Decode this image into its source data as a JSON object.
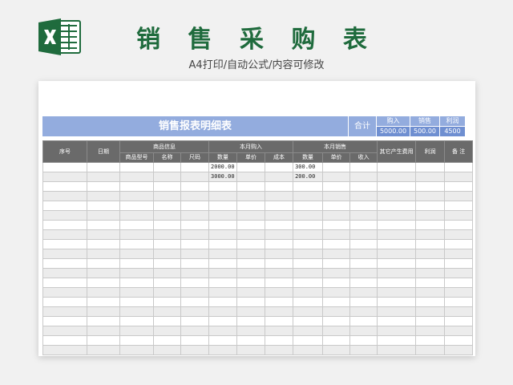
{
  "header": {
    "app_icon": "excel-icon",
    "title": "销 售 采 购 表",
    "subtitle": "A4打印/自动公式/内容可修改"
  },
  "colors": {
    "title_green": "#1f6b3d",
    "bar_blue": "#93acde",
    "bar_value_blue": "#6f8fd1",
    "header_gray": "#6a6a6a"
  },
  "sheet": {
    "bar_title": "销售报表明细表",
    "total_label": "合计",
    "summary": [
      {
        "label": "购入",
        "value": "5000.00"
      },
      {
        "label": "销售",
        "value": "500.00"
      },
      {
        "label": "利润",
        "value": "4500"
      }
    ],
    "headers": {
      "seq": "序号",
      "date": "日期",
      "goods_info": "商品信息",
      "purchase": "本月购入",
      "sales": "本月销售",
      "other_cost": "其它产生费用",
      "profit": "利润",
      "remark": "备 注",
      "model": "商品型号",
      "name": "名称",
      "size": "尺码",
      "p_qty": "数量",
      "p_price": "单价",
      "p_cost": "成本",
      "s_qty": "数量",
      "s_price": "单价",
      "s_income": "收入"
    },
    "rows": [
      {
        "p_qty": "2000.00",
        "s_qty": "300.00"
      },
      {
        "p_qty": "3000.00",
        "s_qty": "200.00"
      },
      {},
      {},
      {},
      {},
      {},
      {},
      {},
      {},
      {},
      {},
      {},
      {},
      {},
      {},
      {},
      {},
      {},
      {}
    ]
  }
}
